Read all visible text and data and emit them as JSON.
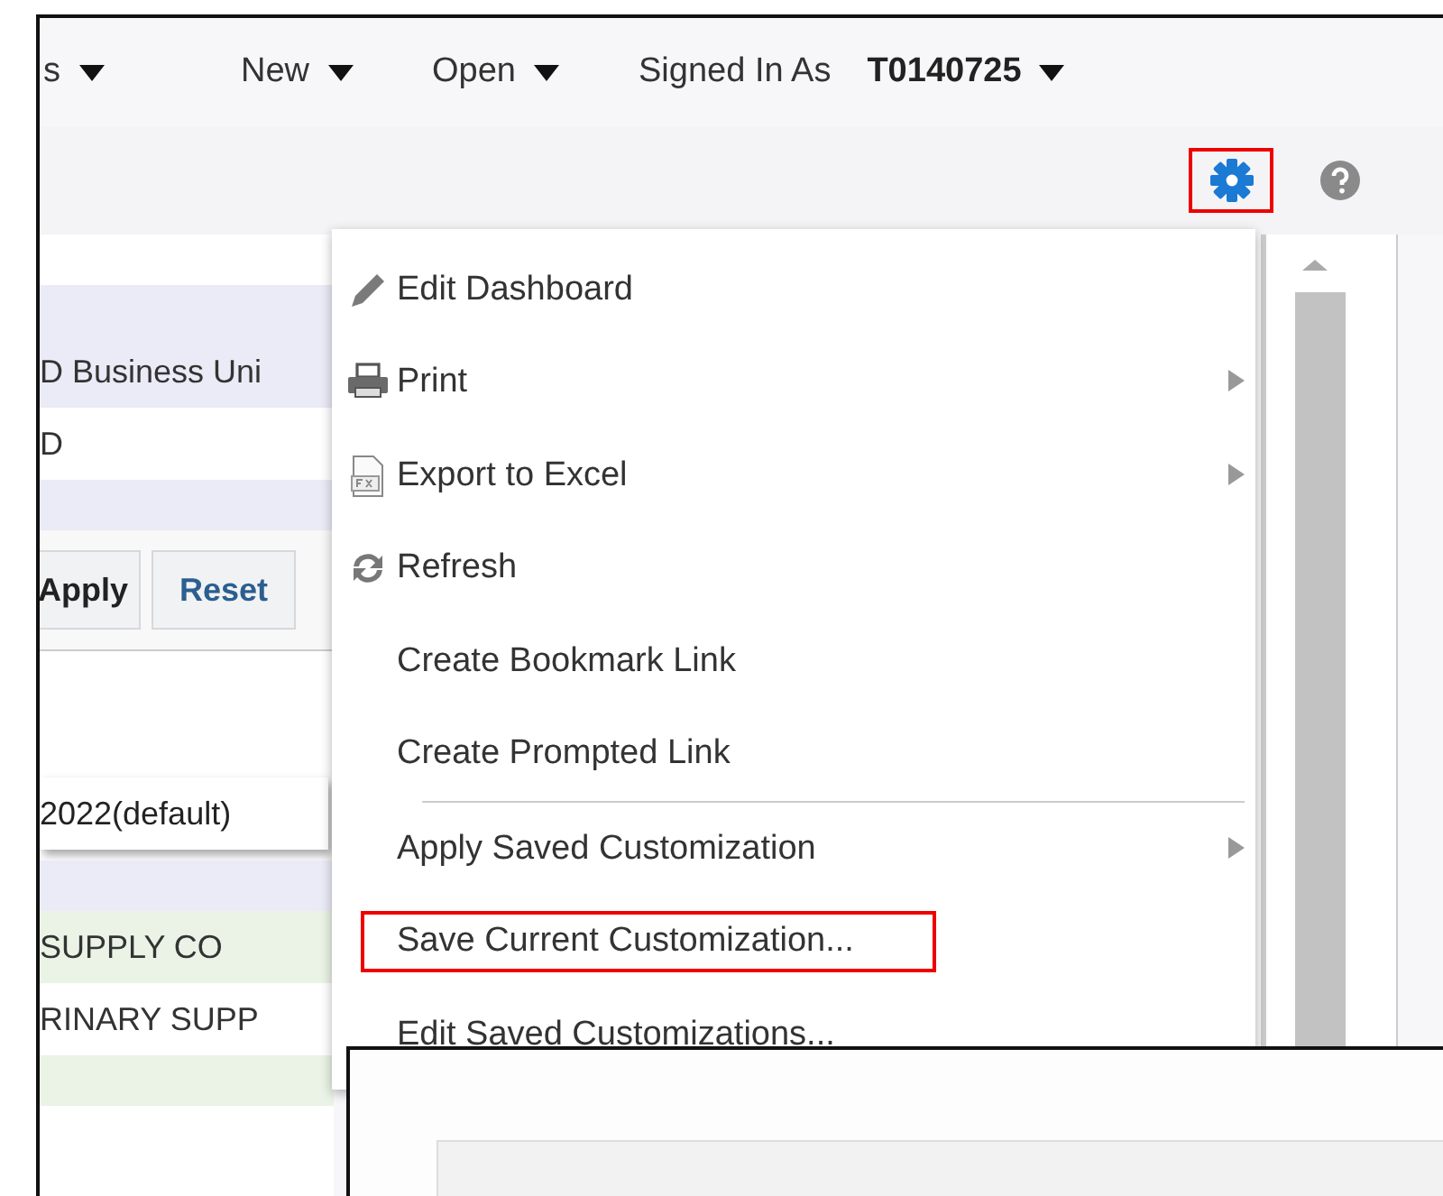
{
  "header": {
    "menus": [
      {
        "label": "s"
      },
      {
        "label": "New"
      },
      {
        "label": "Open"
      }
    ],
    "signed_in_label": "Signed In As",
    "user": "T0140725"
  },
  "toolbar": {
    "settings_highlighted": true
  },
  "left_panel": {
    "rows": [
      {
        "kind": "blank",
        "color": "#ffffff"
      },
      {
        "kind": "blank",
        "color": "#ebeaf7"
      },
      {
        "kind": "text",
        "text": "D Business Uni",
        "color": "#ebeaf7"
      },
      {
        "kind": "text",
        "text": "D",
        "color": "#ffffff"
      },
      {
        "kind": "blank",
        "color": "#ebeaf7"
      },
      {
        "kind": "buttons",
        "buttons": [
          "Apply",
          "Reset"
        ]
      },
      {
        "kind": "blank",
        "color": "#ffffff"
      },
      {
        "kind": "select",
        "text": "2022(default)"
      },
      {
        "kind": "blank",
        "color": "#ebeaf7"
      },
      {
        "kind": "text",
        "text": "SUPPLY CO",
        "color": "#eaf3e6"
      },
      {
        "kind": "text",
        "text": "RINARY SUPP",
        "color": "#ffffff"
      },
      {
        "kind": "blank",
        "color": "#eaf3e6"
      }
    ]
  },
  "menu": {
    "items": [
      {
        "kind": "edit",
        "label": "Edit Dashboard",
        "submenu": false,
        "highlighted": false
      },
      {
        "kind": "print",
        "label": "Print",
        "submenu": true,
        "highlighted": false
      },
      {
        "kind": "export",
        "label": "Export to Excel",
        "submenu": true,
        "highlighted": false
      },
      {
        "kind": "refresh",
        "label": "Refresh",
        "submenu": false,
        "highlighted": false
      },
      {
        "kind": "item",
        "label": "Create Bookmark Link",
        "submenu": false,
        "highlighted": false
      },
      {
        "kind": "item",
        "label": "Create Prompted Link",
        "submenu": false,
        "highlighted": false
      },
      {
        "kind": "separator"
      },
      {
        "kind": "item",
        "label": "Apply Saved Customization",
        "submenu": true,
        "highlighted": false
      },
      {
        "kind": "item",
        "label": "Save Current Customization...",
        "submenu": false,
        "highlighted": true
      },
      {
        "kind": "item",
        "label": "Edit Saved Customizations...",
        "submenu": false,
        "highlighted": false
      }
    ]
  },
  "dialog": {
    "kind": "panel"
  }
}
